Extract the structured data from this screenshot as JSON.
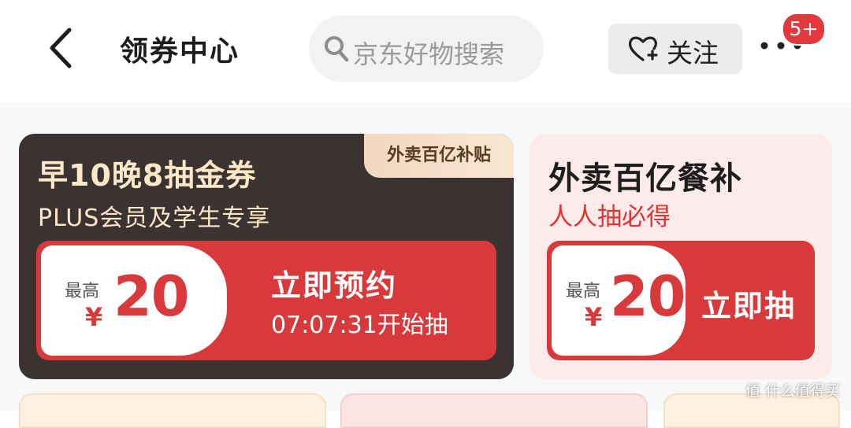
{
  "header": {
    "title": "领券中心",
    "search_placeholder": "京东好物搜索",
    "follow_label": "关注",
    "more_badge": "5+"
  },
  "left_card": {
    "tag": "外卖百亿补贴",
    "title": "早10晚8抽金券",
    "subtitle": "PLUS会员及学生专享",
    "coupon": {
      "max_label": "最高",
      "currency": "¥",
      "amount": "20",
      "action": "立即预约",
      "countdown": "07:07:31开始抽"
    }
  },
  "right_card": {
    "title": "外卖百亿餐补",
    "subtitle": "人人抽必得",
    "coupon": {
      "max_label": "最高",
      "currency": "¥",
      "amount": "20",
      "action": "立即抽"
    }
  },
  "watermark": "值 什么值得买",
  "colors": {
    "accent_red": "#d8393a",
    "dark_card": "#3a3331",
    "gold_text": "#ffe8c7",
    "pink_card": "#fdeaea"
  },
  "icons": [
    "back-arrow-icon",
    "search-icon",
    "heart-plus-icon",
    "more-dots-icon"
  ]
}
